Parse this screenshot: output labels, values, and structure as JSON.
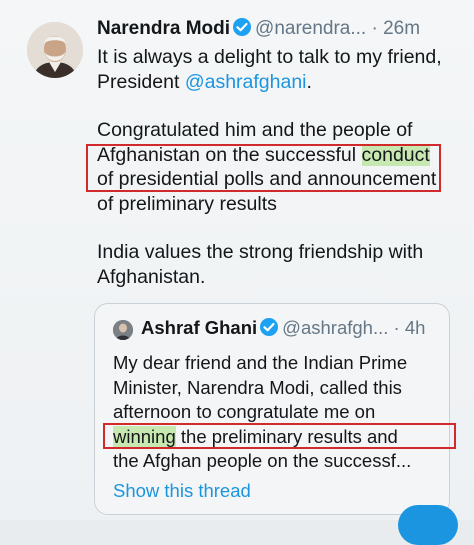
{
  "tweet": {
    "author_name": "Narendra Modi",
    "author_handle": "@narendra...",
    "separator": "·",
    "time": "26m",
    "line1": "It is always a delight to talk to my friend,",
    "line2_prefix": "President ",
    "line2_mention": "@ashrafghani",
    "line2_suffix": ".",
    "line3": "Congratulated him and the people of",
    "line4_prefix": "Afghanistan on the successful ",
    "line4_highlight": "conduct",
    "line5": "of presidential polls and announcement",
    "line6": "of preliminary results",
    "line7": "India values the strong friendship with",
    "line8": "Afghanistan."
  },
  "quoted_tweet": {
    "author_name": "Ashraf Ghani",
    "author_handle": "@ashrafgh...",
    "separator": "·",
    "time": "4h",
    "line1": "My dear friend and the Indian Prime",
    "line2": "Minister, Narendra Modi, called this",
    "line3": "afternoon to congratulate me on",
    "line4_highlight": "winning",
    "line4_rest": " the preliminary results and",
    "line5": "the Afghan people on the successf...",
    "show_thread": "Show this thread"
  },
  "colors": {
    "link_blue": "#1b95e0",
    "verified_blue": "#1da1f2",
    "annotation_red": "#d22a2a",
    "highlight_green": "#a4dc78"
  }
}
